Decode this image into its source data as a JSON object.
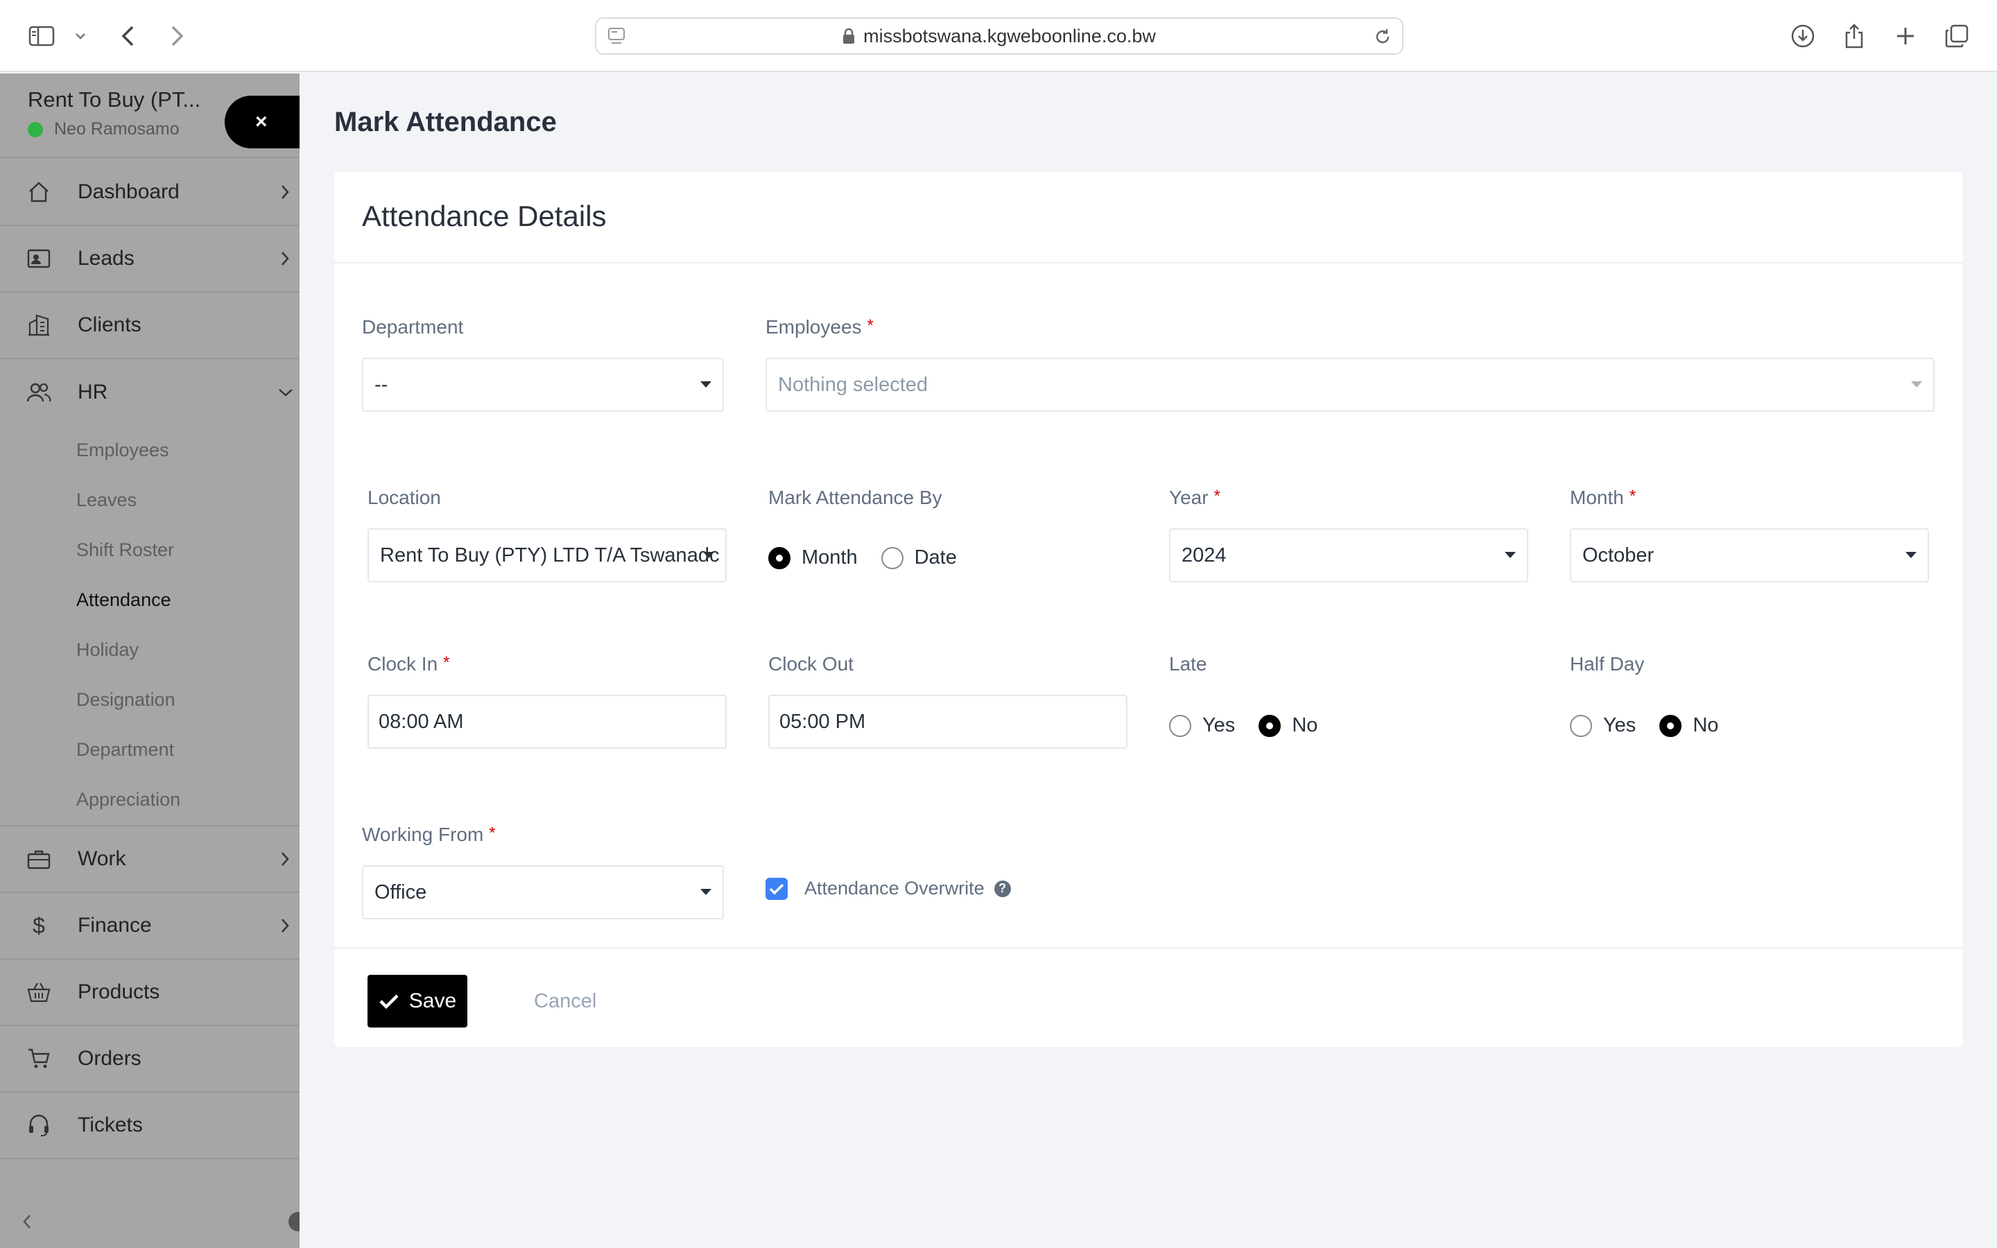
{
  "browser": {
    "url": "missbotswana.kgweboonline.co.bw",
    "icons": [
      "sidebar-toggle-icon",
      "chevron-down-icon",
      "back-icon",
      "forward-icon",
      "lock-icon",
      "reload-icon",
      "download-icon",
      "share-icon",
      "new-tab-icon",
      "tabs-icon"
    ]
  },
  "sidebar": {
    "company": "Rent To Buy (PT...",
    "user": "Neo Ramosamo",
    "close_label": "×",
    "items": [
      {
        "label": "Dashboard",
        "icon": "house-icon"
      },
      {
        "label": "Leads",
        "icon": "id-card-icon"
      },
      {
        "label": "Clients",
        "icon": "building-icon"
      },
      {
        "label": "HR",
        "icon": "people-icon"
      },
      {
        "label": "Work",
        "icon": "briefcase-icon"
      },
      {
        "label": "Finance",
        "icon": "dollar-icon"
      },
      {
        "label": "Products",
        "icon": "basket-icon"
      },
      {
        "label": "Orders",
        "icon": "cart-icon"
      },
      {
        "label": "Tickets",
        "icon": "headset-icon"
      }
    ],
    "hr_sub": [
      "Employees",
      "Leaves",
      "Shift Roster",
      "Attendance",
      "Holiday",
      "Designation",
      "Department",
      "Appreciation"
    ],
    "active_sub": "Attendance"
  },
  "main": {
    "page_title": "Mark Attendance",
    "card_title": "Attendance Details",
    "department": {
      "label": "Department",
      "value": "--"
    },
    "employees": {
      "label": "Employees",
      "required": "*",
      "placeholder": "Nothing selected"
    },
    "location": {
      "label": "Location",
      "value": "Rent To Buy (PTY) LTD T/A Tswanadc"
    },
    "mark_by": {
      "label": "Mark Attendance By",
      "options": [
        "Month",
        "Date"
      ],
      "selected": "Month"
    },
    "year": {
      "label": "Year",
      "required": "*",
      "value": "2024"
    },
    "month": {
      "label": "Month",
      "required": "*",
      "value": "October"
    },
    "clock_in": {
      "label": "Clock In",
      "required": "*",
      "value": "08:00 AM"
    },
    "clock_out": {
      "label": "Clock Out",
      "value": "05:00 PM"
    },
    "late": {
      "label": "Late",
      "options": [
        "Yes",
        "No"
      ],
      "selected": "No"
    },
    "half_day": {
      "label": "Half Day",
      "options": [
        "Yes",
        "No"
      ],
      "selected": "No"
    },
    "working_from": {
      "label": "Working From",
      "required": "*",
      "value": "Office"
    },
    "overwrite": {
      "label": "Attendance Overwrite",
      "checked": true,
      "help": "?"
    },
    "save_label": "Save",
    "cancel_label": "Cancel"
  },
  "colors": {
    "accent": "#000000",
    "checkbox": "#3b82f6",
    "required": "#d30000",
    "online": "#2fb344"
  }
}
